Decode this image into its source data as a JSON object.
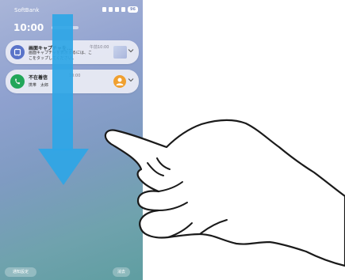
{
  "status_bar": {
    "carrier": "SoftBank",
    "battery": "96"
  },
  "lock": {
    "time": "10:00"
  },
  "notifications": [
    {
      "app": "screen-capture",
      "title": "画面キャプチャを...",
      "time": "午前10:00",
      "body": "画面キャプチャを表示するには、ここをタップしてください。"
    },
    {
      "app": "phone",
      "title": "不在着信",
      "time": "10:00",
      "body": "携帯　太郎"
    }
  ],
  "bottom_bar": {
    "settings_label": "通知設定",
    "clear_label": "消去"
  },
  "colors": {
    "arrow": "#2ea6e6",
    "phone_app": "#22a65a",
    "capture_app": "#5a74c9"
  },
  "icons": {
    "swipe_arrow": "arrow-down-icon",
    "gesture": "hand-swipe-icon"
  }
}
